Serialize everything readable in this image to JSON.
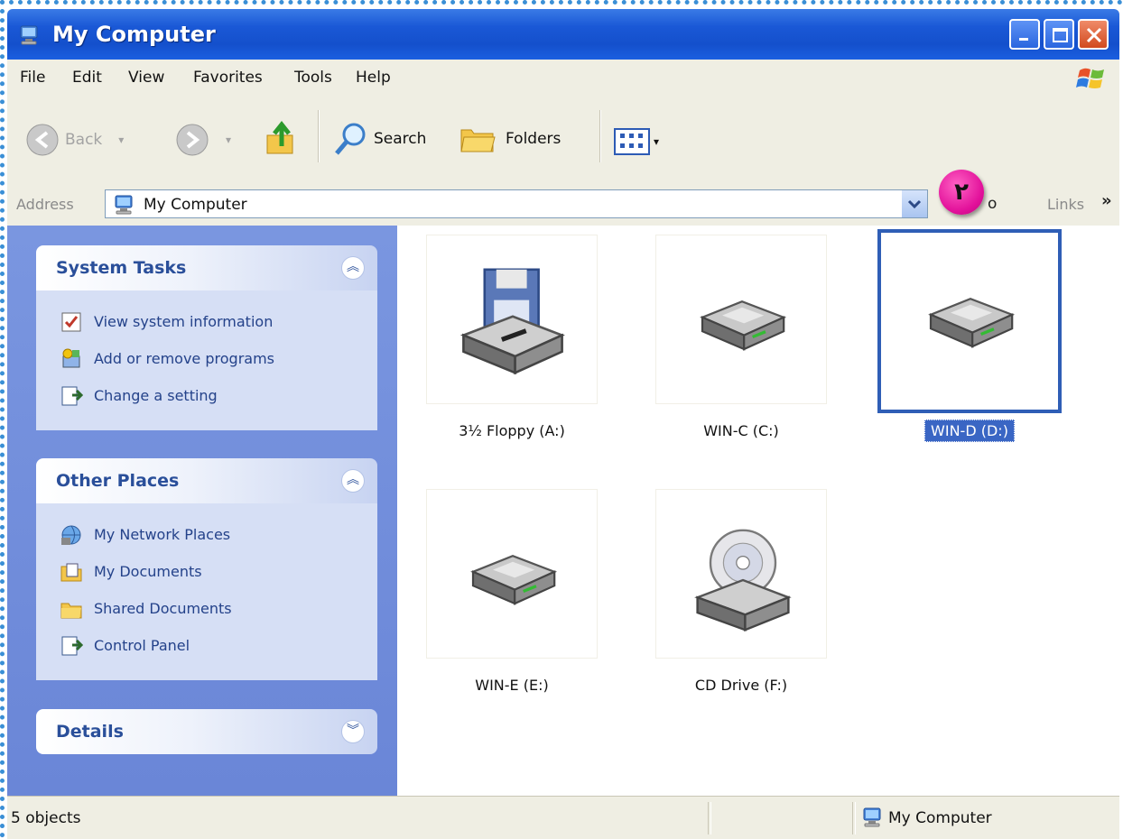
{
  "window": {
    "title": "My Computer"
  },
  "menu": [
    "File",
    "Edit",
    "View",
    "Favorites",
    "Tools",
    "Help"
  ],
  "toolbar": {
    "back": "Back",
    "search": "Search",
    "folders": "Folders"
  },
  "address": {
    "label": "Address",
    "value": "My Computer",
    "go_partial": "o",
    "links": "Links"
  },
  "callout": {
    "number": "۲",
    "color": "#e2109a"
  },
  "sidebar": {
    "system_tasks": {
      "title": "System Tasks",
      "items": [
        "View system information",
        "Add or remove programs",
        "Change a setting"
      ]
    },
    "other_places": {
      "title": "Other Places",
      "items": [
        "My Network Places",
        "My Documents",
        "Shared Documents",
        "Control Panel"
      ]
    },
    "details": {
      "title": "Details"
    }
  },
  "drives": [
    {
      "label": "3½ Floppy (A:)",
      "icon": "floppy-drive-icon"
    },
    {
      "label": "WIN-C (C:)",
      "icon": "hard-drive-icon"
    },
    {
      "label": "WIN-D (D:)",
      "icon": "hard-drive-icon",
      "selected": true
    },
    {
      "label": "WIN-E (E:)",
      "icon": "hard-drive-icon"
    },
    {
      "label": "CD Drive (F:)",
      "icon": "cd-drive-icon"
    }
  ],
  "status": {
    "left": "5 objects",
    "right": "My Computer"
  },
  "colors": {
    "titlebar": "#1450cc",
    "taskpane": "#6a86d7",
    "selection": "#2f5eb6"
  }
}
